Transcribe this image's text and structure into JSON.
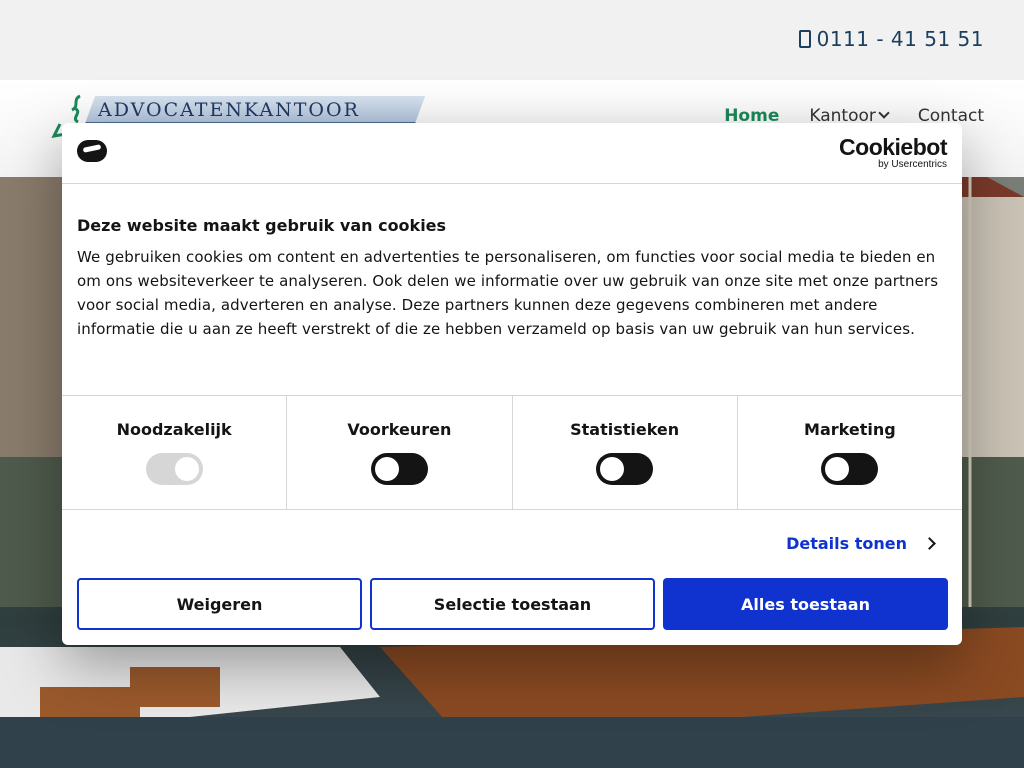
{
  "topbar": {
    "phone": "0111 - 41 51 51",
    "phone_icon": "phone-icon"
  },
  "header": {
    "logo_text": "ADVOCATENKANTOOR",
    "nav": [
      {
        "label": "Home",
        "active": true
      },
      {
        "label": "Kantoor",
        "has_dropdown": true
      },
      {
        "label": "Contact"
      }
    ]
  },
  "cookie_dialog": {
    "brand": "Cookiebot",
    "brand_sub": "by Usercentrics",
    "title": "Deze website maakt gebruik van cookies",
    "text": "We gebruiken cookies om content en advertenties te personaliseren, om functies voor social media te bieden en om ons websiteverkeer te analyseren. Ook delen we informatie over uw gebruik van onze site met onze partners voor social media, adverteren en analyse. Deze partners kunnen deze gegevens combineren met andere informatie die u aan ze heeft verstrekt of die ze hebben verzameld op basis van uw gebruik van hun services.",
    "categories": [
      {
        "label": "Noodzakelijk",
        "checked": true,
        "disabled": true
      },
      {
        "label": "Voorkeuren",
        "checked": false
      },
      {
        "label": "Statistieken",
        "checked": false
      },
      {
        "label": "Marketing",
        "checked": false
      }
    ],
    "details_link": "Details tonen",
    "buttons": {
      "decline": "Weigeren",
      "allow_selection": "Selectie toestaan",
      "allow_all": "Alles toestaan"
    }
  },
  "colors": {
    "accent": "#1032cf",
    "nav_active": "#1a8a5a",
    "phone": "#1d3f5e"
  }
}
